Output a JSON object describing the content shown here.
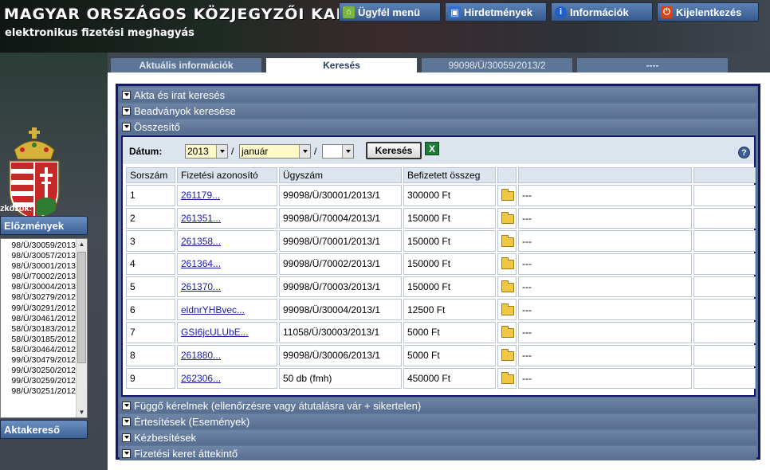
{
  "header": {
    "title": "MAGYAR ORSZÁGOS KÖZJEGYZŐI KAMARA",
    "subtitle": "elektronikus fizetési meghagyás"
  },
  "top_menu": {
    "ugyfel": "Ügyfél menü",
    "hirdetmenyek": "Hirdetmények",
    "informaciok": "Információk",
    "kijelentkezes": "Kijelentkezés"
  },
  "sidebar": {
    "tools_label": "zközök:",
    "elozmenyek_label": "Előzmények",
    "aktakereso_label": "Aktakereső",
    "history": [
      "98/Ü/30059/2013",
      "98/Ü/30057/2013",
      "98/Ü/30001/2013",
      "98/Ü/70002/2013",
      "98/Ü/30004/2013",
      "98/Ü/30279/2012",
      "99/Ü/30291/2012",
      "98/Ü/30461/2012",
      "58/Ü/30183/2012",
      "58/Ü/30185/2012",
      "58/Ü/30464/2012",
      "99/Ü/30479/2012",
      "99/Ü/30250/2012",
      "99/Ü/30259/2012",
      "98/Ü/30251/2012"
    ]
  },
  "tabs": [
    {
      "label": "Aktuális információk"
    },
    {
      "label": "Keresés"
    },
    {
      "label": "99098/Ü/30059/2013/2"
    },
    {
      "label": "----"
    }
  ],
  "accordion": {
    "akta": "Akta és irat keresés",
    "beadvanyok": "Beadványok keresése",
    "osszesito": "Összesítő",
    "fuggo": "Függő kérelmek (ellenőrzésre vagy átutalásra vár + sikertelen)",
    "ertesitesek": "Értesítések (Események)",
    "kezbesitesek": "Kézbesítések",
    "fizetesi_keret": "Fizetési keret áttekintő"
  },
  "filter": {
    "datum_label": "Dátum:",
    "year": "2013",
    "month": "január",
    "day": "",
    "search_label": "Keresés",
    "slash": "/"
  },
  "table": {
    "headers": [
      "Sorszám",
      "Fizetési azonosító",
      "Ügyszám",
      "Befizetett összeg",
      "",
      "",
      ""
    ],
    "rows": [
      {
        "num": "1",
        "id": "261179...",
        "case": "99098/Ü/30001/2013/1",
        "amount": "300000 Ft",
        "note": "---"
      },
      {
        "num": "2",
        "id": "261351...",
        "case": "99098/Ü/70004/2013/1",
        "amount": "150000 Ft",
        "note": "---"
      },
      {
        "num": "3",
        "id": "261358...",
        "case": "99098/Ü/70001/2013/1",
        "amount": "150000 Ft",
        "note": "---"
      },
      {
        "num": "4",
        "id": "261364...",
        "case": "99098/Ü/70002/2013/1",
        "amount": "150000 Ft",
        "note": "---"
      },
      {
        "num": "5",
        "id": "261370...",
        "case": "99098/Ü/70003/2013/1",
        "amount": "150000 Ft",
        "note": "---"
      },
      {
        "num": "6",
        "id": "eldnrYHBvec...",
        "case": "99098/Ü/30004/2013/1",
        "amount": "12500 Ft",
        "note": "---"
      },
      {
        "num": "7",
        "id": "GSI6jcULUbE...",
        "case": "11058/Ü/30003/2013/1",
        "amount": "5000 Ft",
        "note": "---"
      },
      {
        "num": "8",
        "id": "261880...",
        "case": "99098/Ü/30006/2013/1",
        "amount": "5000 Ft",
        "note": "---"
      },
      {
        "num": "9",
        "id": "262306...",
        "case": "50 db (fmh)",
        "amount": "450000 Ft",
        "note": "---"
      }
    ]
  },
  "colors": {
    "panel_border": "#15186a",
    "accordion_bg": "#5d7596",
    "select_bg": "#fff8c8",
    "link": "#1a1aaa"
  }
}
